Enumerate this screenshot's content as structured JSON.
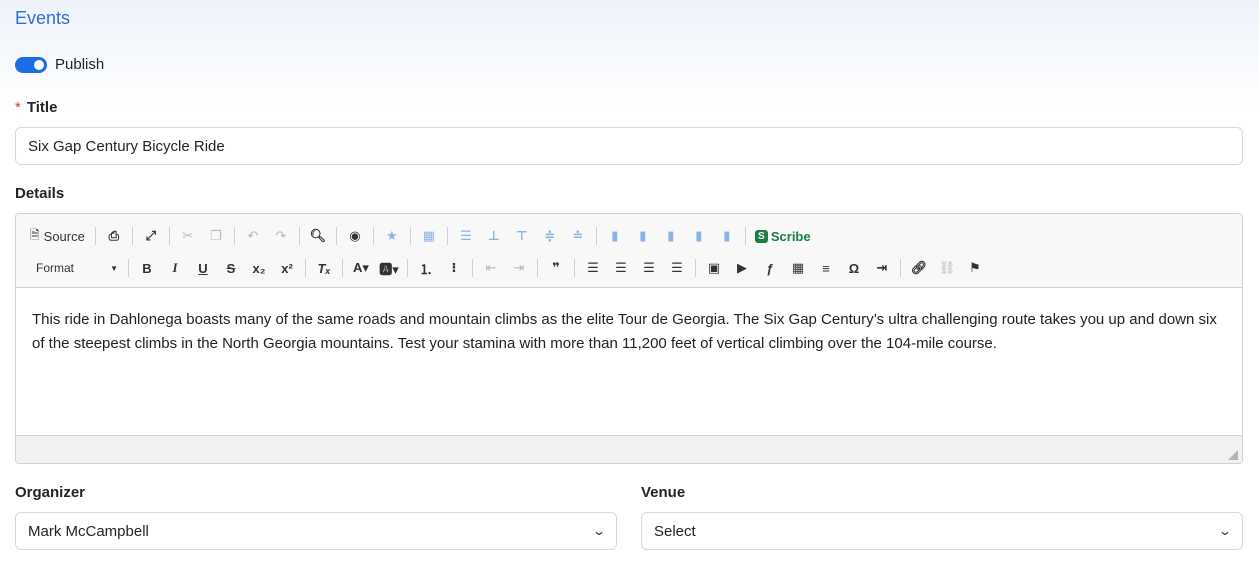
{
  "page": {
    "title": "Events"
  },
  "publish": {
    "label": "Publish",
    "enabled": true
  },
  "title_field": {
    "label": "Title",
    "required_marker": "*",
    "value": "Six Gap Century Bicycle Ride"
  },
  "details": {
    "label": "Details",
    "toolbar": {
      "source_label": "Source",
      "scribe_label": "Scribe",
      "format_label": "Format"
    },
    "content": "This ride in Dahlonega boasts many of the same roads and mountain climbs as the elite Tour de Georgia. The Six Gap Century’s ultra challenging route takes you up and down six of the steepest climbs in the North Georgia mountains. Test your stamina with more than 11,200 feet of vertical climbing over the 104-mile course."
  },
  "organizer": {
    "label": "Organizer",
    "value": "Mark McCampbell"
  },
  "venue": {
    "label": "Venue",
    "value": "Select"
  },
  "colors": {
    "accent": "#1a6ee8",
    "title": "#2f6fd6",
    "required": "#d63a3a",
    "scribe": "#1e7c45"
  }
}
